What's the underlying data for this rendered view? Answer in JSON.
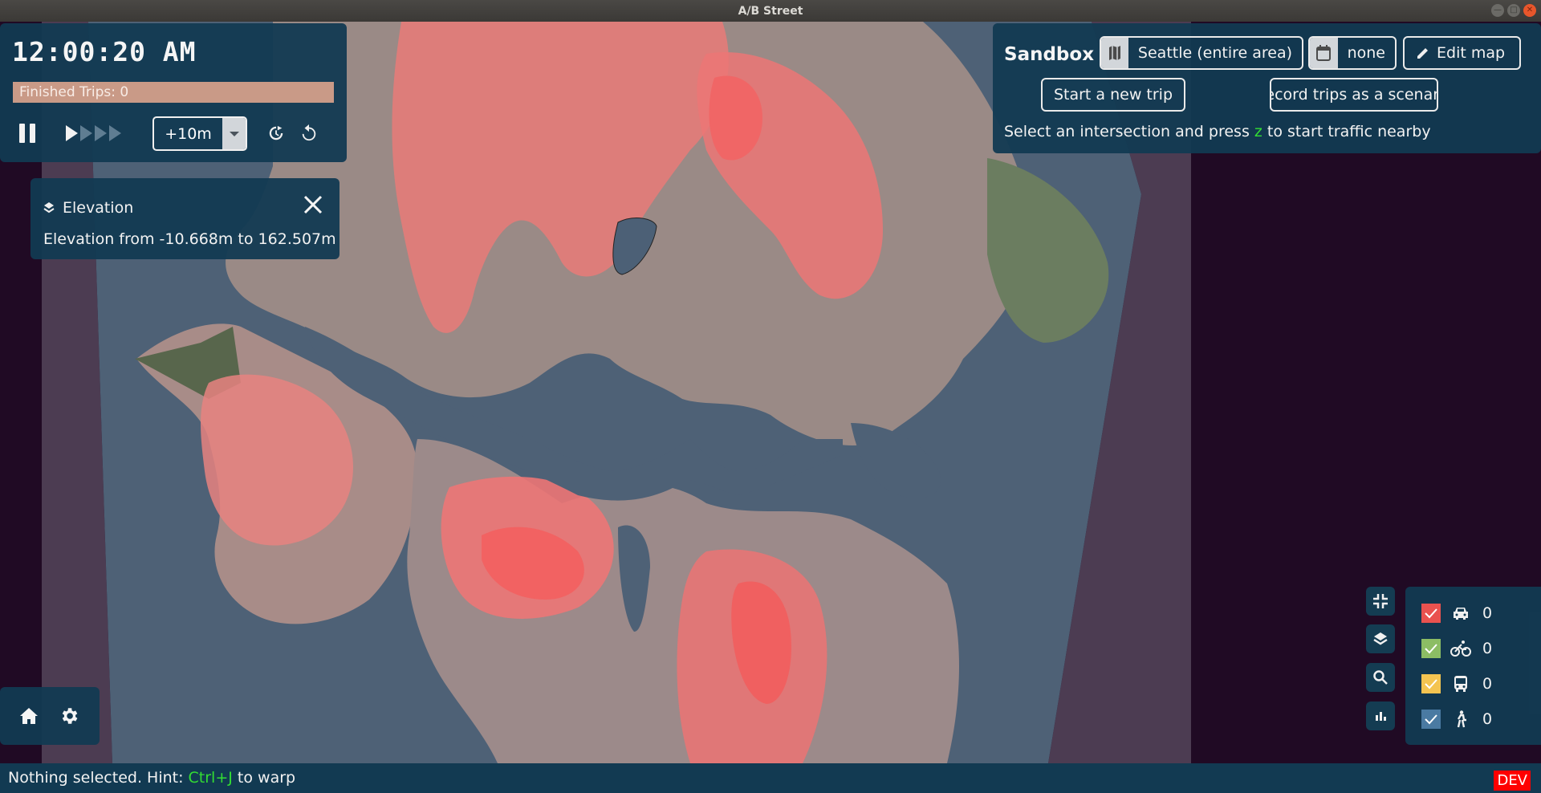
{
  "window": {
    "title": "A/B Street",
    "controls": [
      "minimize",
      "maximize",
      "close"
    ]
  },
  "time_panel": {
    "clock": "12:00:20 AM",
    "finished_trips_label": "Finished Trips: 0",
    "finished_trips_progress": 1.0,
    "step_value": "+10m",
    "speed_levels": 4,
    "active_speed": 1,
    "icons": [
      "pause-icon",
      "play-icon",
      "fast-forward-icon",
      "jump-to-time-icon",
      "reset-icon"
    ]
  },
  "elevation_panel": {
    "title": "Elevation",
    "description": "Elevation from -10.668m to 162.507m",
    "icons": [
      "layers-icon",
      "close-icon"
    ]
  },
  "sandbox_panel": {
    "title": "Sandbox",
    "map_button": "Seattle (entire area)",
    "scenario_button": "none",
    "edit_button": "Edit map",
    "start_trip_button": "Start a new trip",
    "record_button": "Record trips as a scenario",
    "hint_prefix": "Select an intersection and press ",
    "hint_key": "z",
    "hint_suffix": " to start traffic nearby"
  },
  "minimap_tools": [
    "zoom-to-fit-icon",
    "layers-icon",
    "search-icon",
    "chart-icon"
  ],
  "legend": {
    "items": [
      {
        "mode": "car",
        "color": "#e9524f",
        "checked": true,
        "count": "0"
      },
      {
        "mode": "bike",
        "color": "#8cbd64",
        "checked": true,
        "count": "0"
      },
      {
        "mode": "bus",
        "color": "#f4c451",
        "checked": true,
        "count": "0"
      },
      {
        "mode": "pedestrian",
        "color": "#4a7aa2",
        "checked": true,
        "count": "0"
      }
    ]
  },
  "bottom_left": {
    "icons": [
      "home-icon",
      "settings-icon"
    ]
  },
  "status_bar": {
    "prefix": "Nothing selected. Hint: ",
    "key": "Ctrl+J",
    "suffix": " to warp",
    "badge": "DEV"
  },
  "colors": {
    "panel": "#123a52",
    "accent_key": "#33dd33",
    "water": "#4e6176",
    "elevation_high": "#ef6a6a",
    "dev_badge": "#ff0000"
  }
}
